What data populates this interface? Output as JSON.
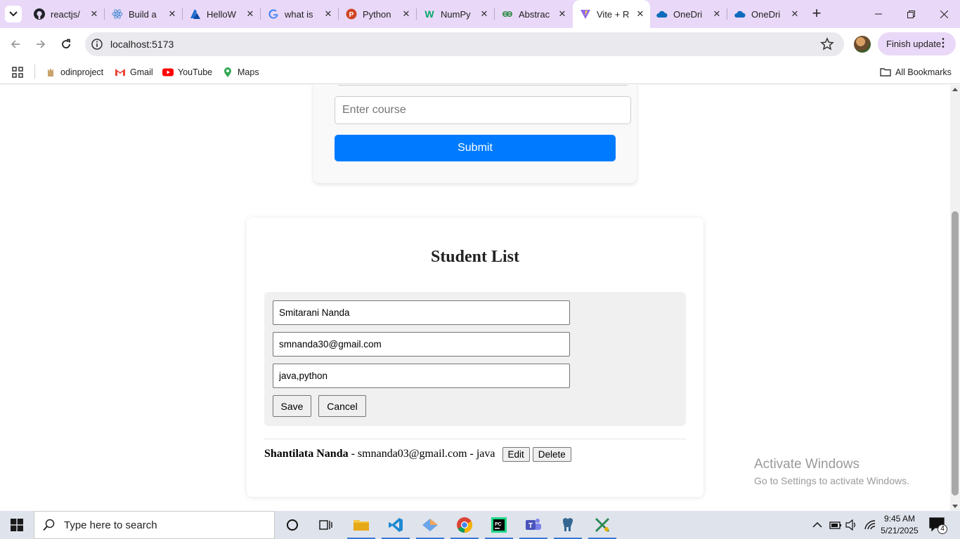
{
  "browser": {
    "tabs": [
      {
        "title": "reactjs/",
        "icon": "github-icon"
      },
      {
        "title": "Build a",
        "icon": "react-icon"
      },
      {
        "title": "HelloW",
        "icon": "azure-icon"
      },
      {
        "title": "what is",
        "icon": "google-icon"
      },
      {
        "title": "Python",
        "icon": "powerpoint-icon"
      },
      {
        "title": "NumPy",
        "icon": "w3schools-icon"
      },
      {
        "title": "Abstrac",
        "icon": "geeksforgeeks-icon"
      },
      {
        "title": "Vite + R",
        "icon": "vite-icon",
        "active": true
      },
      {
        "title": "OneDri",
        "icon": "onedrive-icon"
      },
      {
        "title": "OneDri",
        "icon": "onedrive-icon"
      }
    ],
    "url": "localhost:5173",
    "finish_update_label": "Finish update",
    "bookmarks": [
      {
        "label": "odinproject",
        "icon": "odinproject-icon"
      },
      {
        "label": "Gmail",
        "icon": "gmail-icon"
      },
      {
        "label": "YouTube",
        "icon": "youtube-icon"
      },
      {
        "label": "Maps",
        "icon": "maps-icon"
      }
    ],
    "all_bookmarks_label": "All Bookmarks"
  },
  "page": {
    "course_placeholder": "Enter course",
    "submit_label": "Submit",
    "list_title": "Student List",
    "edit_form": {
      "name_value": "Smitarani Nanda",
      "email_value": "smnanda30@gmail.com",
      "course_value": "java,python",
      "save_label": "Save",
      "cancel_label": "Cancel"
    },
    "students": [
      {
        "name": "Shantilata Nanda",
        "separator1": " - ",
        "email": "smnanda03@gmail.com",
        "separator2": " - ",
        "course": "java",
        "edit_label": "Edit",
        "delete_label": "Delete"
      }
    ],
    "primary_color": "#007bff"
  },
  "watermark": {
    "line1": "Activate Windows",
    "line2": "Go to Settings to activate Windows."
  },
  "taskbar": {
    "search_placeholder": "Type here to search",
    "time": "9:45 AM",
    "date": "5/21/2025",
    "notification_count": "4"
  }
}
